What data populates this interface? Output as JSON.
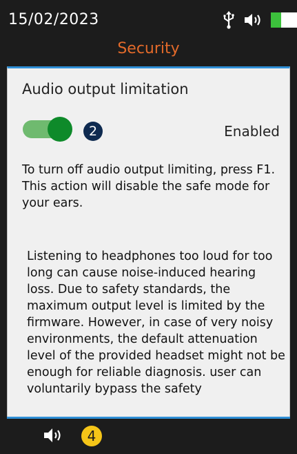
{
  "header": {
    "date": "15/02/2023",
    "title": "Security",
    "icons": [
      "usb-icon",
      "speaker-icon",
      "battery-icon"
    ],
    "battery_level": 0.4
  },
  "panel": {
    "section_title": "Audio output limitation",
    "toggle_on": true,
    "badge": "2",
    "status": "Enabled",
    "instructions": [
      "To turn off audio output limiting, press F1.",
      "This action will disable the safe mode for your ears."
    ],
    "info": "Listening to headphones too loud for too long can cause noise-induced hearing loss. Due to safety standards, the maximum output level is limited by the firmware. However, in case of very noisy environments, the default attenuation level of the provided headset might not be enough for reliable diagnosis. user can voluntarily bypass the safety"
  },
  "footer": {
    "icon": "speaker-icon",
    "badge": "4"
  },
  "colors": {
    "background": "#1c1c1c",
    "title": "#e36a2a",
    "accent_line": "#2f8fd6",
    "toggle_track": "#6fba6f",
    "toggle_knob": "#0e8a2a",
    "badge_dark": "#0e2a50",
    "badge_yellow": "#f5c518",
    "battery": "#3cc13c"
  }
}
